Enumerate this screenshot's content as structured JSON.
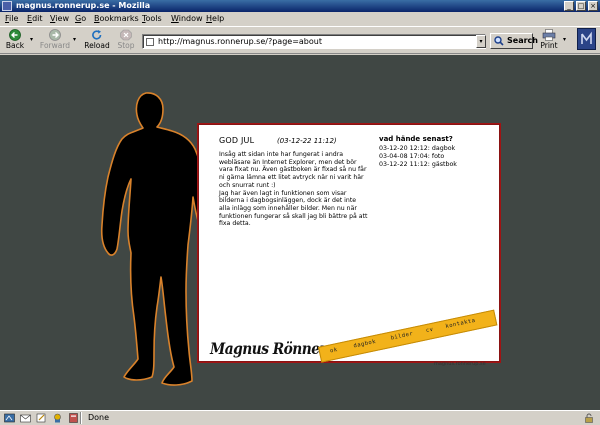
{
  "window": {
    "title": "magnus.ronnerup.se - Mozilla"
  },
  "menu": [
    "File",
    "Edit",
    "View",
    "Go",
    "Bookmarks",
    "Tools",
    "Window",
    "Help"
  ],
  "toolbar": {
    "back": "Back",
    "forward": "Forward",
    "reload": "Reload",
    "stop": "Stop",
    "search": "Search",
    "print": "Print"
  },
  "address": {
    "url": "http://magnus.ronnerup.se/?page=about"
  },
  "page": {
    "post": {
      "title": "GOD JUL",
      "date": "(03-12-22 11:12)",
      "paragraphs": [
        "Insåg att sidan inte har fungerat i andra webläsare än Internet Explorer, men det bör vara fixat nu. Även gästboken är fixad så nu får ni gärna lämna ett litet avtryck när ni varit här och snurrat runt :)",
        "Jag har även lagt in funktionen som visar bilderna i dagbogsinläggen, dock är det inte alla inlägg som innehåller bilder. Men nu när funktionen fungerar så skall jag bli bättre på att fixa detta."
      ]
    },
    "sidebar": {
      "title": "vad hände senast?",
      "items": [
        "03-12-20 12:12: dagbok",
        "03-04-08 17:04: foto",
        "03-12-22 11:12: gästbok"
      ]
    },
    "site_name": "Magnus Rönnerup",
    "nav": [
      "ok",
      "dagbok",
      "bilder",
      "cv",
      "kontakta"
    ],
    "credit": "magnus.ronnerup.se"
  },
  "status": {
    "text": "Done"
  },
  "colors": {
    "page_bg": "#404744",
    "card_border": "#8a1212",
    "tape": "#f2b21a",
    "silhouette_outline": "#d9822b"
  }
}
